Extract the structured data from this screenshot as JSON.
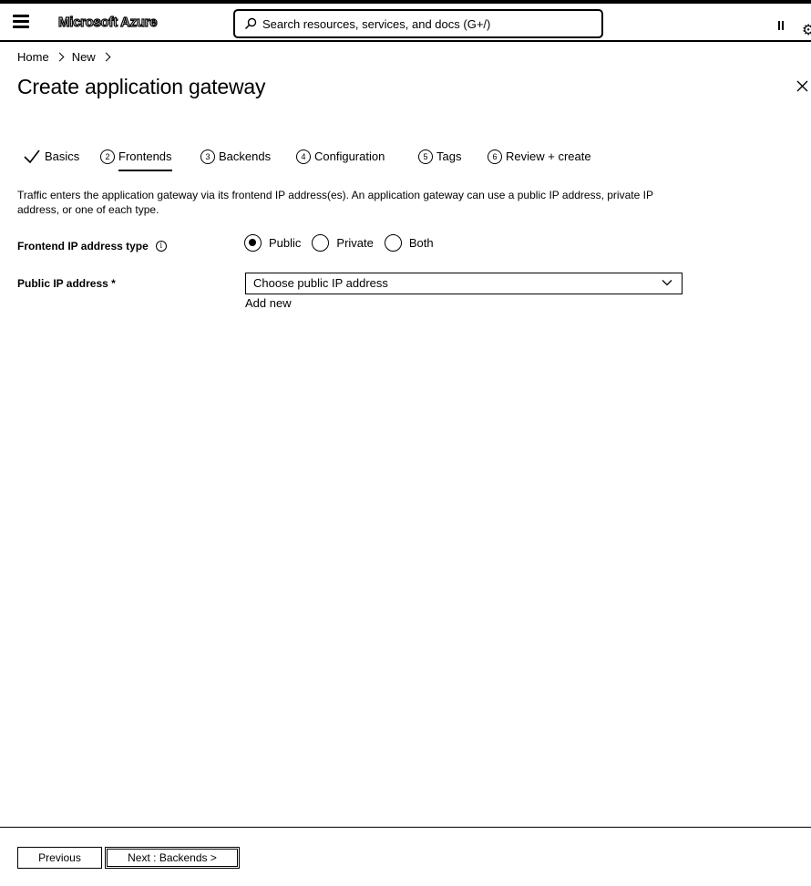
{
  "topbar": {
    "brand": "Microsoft Azure",
    "search_placeholder": "Search resources, services, and docs (G+/)"
  },
  "breadcrumb": {
    "items": [
      "Home",
      "New"
    ]
  },
  "page_title": "Create application gateway",
  "tabs": [
    {
      "num": "",
      "label": "Basics",
      "state": "completed"
    },
    {
      "num": "2",
      "label": "Frontends",
      "state": "active"
    },
    {
      "num": "3",
      "label": "Backends",
      "state": "pending"
    },
    {
      "num": "4",
      "label": "Configuration",
      "state": "pending"
    },
    {
      "num": "5",
      "label": "Tags",
      "state": "pending"
    },
    {
      "num": "6",
      "label": "Review + create",
      "state": "pending"
    }
  ],
  "description": "Traffic enters the application gateway via its frontend IP address(es). An application gateway can use a public IP address, private IP address, or one of each type.",
  "form": {
    "frontend_ip_type": {
      "label": "Frontend IP address type",
      "info": "i",
      "options": [
        "Public",
        "Private",
        "Both"
      ],
      "selected": "Public"
    },
    "public_ip": {
      "label": "Public IP address *",
      "placeholder": "Choose public IP address",
      "add_new": "Add new"
    }
  },
  "footer": {
    "previous": "Previous",
    "next": "Next : Backends >"
  }
}
